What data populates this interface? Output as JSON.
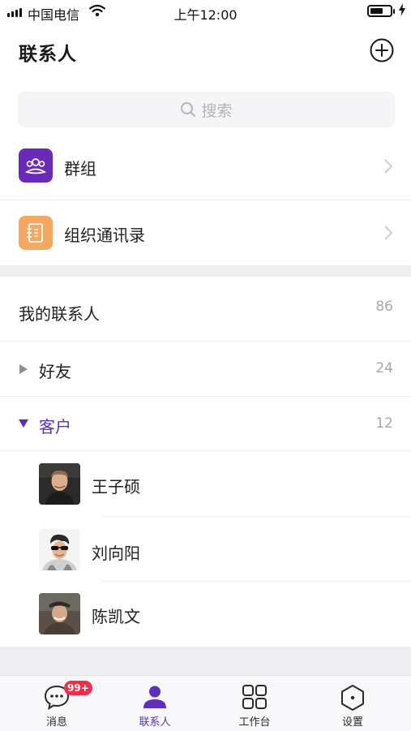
{
  "status_bar": {
    "carrier": "中国电信",
    "time": "上午12:00"
  },
  "header": {
    "title": "联系人"
  },
  "search": {
    "placeholder": "搜索"
  },
  "menu": [
    {
      "label": "群组",
      "icon": "group-icon",
      "color": "#6a2bb8"
    },
    {
      "label": "组织通讯录",
      "icon": "address-book-icon",
      "color": "#f7a860"
    }
  ],
  "my_contacts": {
    "label": "我的联系人",
    "count": "86"
  },
  "groups": [
    {
      "label": "好友",
      "count": "24",
      "expanded": false
    },
    {
      "label": "客户",
      "count": "12",
      "expanded": true
    }
  ],
  "contacts": [
    {
      "name": "王子硕",
      "avatar": "avatar-photo"
    },
    {
      "name": "刘向阳",
      "avatar": "avatar-photo"
    },
    {
      "name": "陈凯文",
      "avatar": "avatar-photo"
    }
  ],
  "tabs": [
    {
      "label": "消息",
      "icon": "chat-bubble-icon",
      "badge": "99+"
    },
    {
      "label": "联系人",
      "icon": "person-icon",
      "active": true
    },
    {
      "label": "工作台",
      "icon": "grid-icon"
    },
    {
      "label": "设置",
      "icon": "hexagon-settings-icon"
    }
  ],
  "colors": {
    "accent": "#5c2fbf",
    "badge": "#f02e4a",
    "count_text": "#a7a7ab"
  }
}
